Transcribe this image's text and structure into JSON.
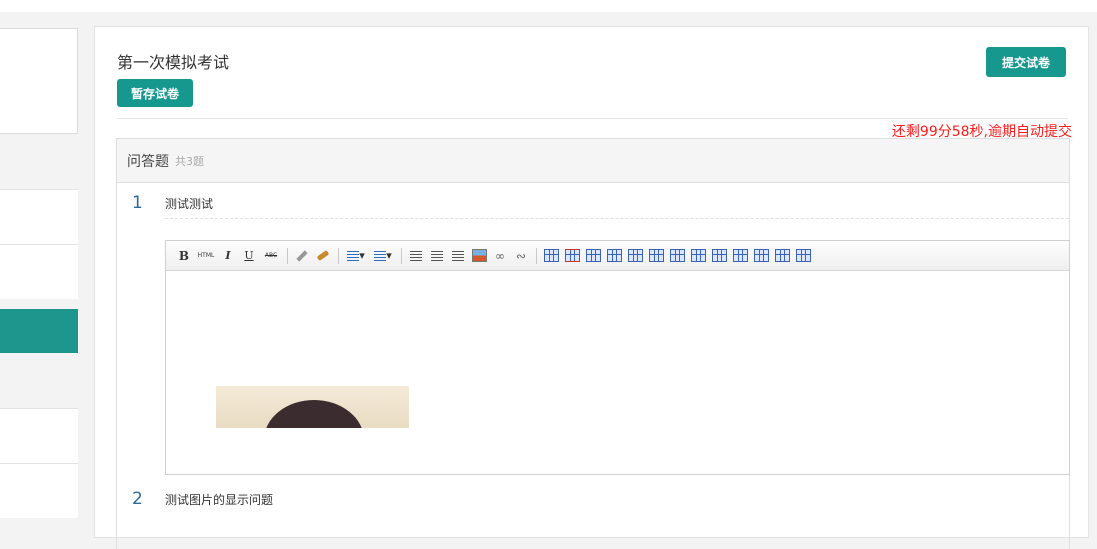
{
  "exam": {
    "title": "第一次模拟考试",
    "save_label": "暂存试卷",
    "submit_label": "提交试卷",
    "timer_text": "还剩99分58秒,逾期自动提交"
  },
  "section": {
    "title": "问答题",
    "count": "共3题"
  },
  "questions": [
    {
      "number": "1",
      "text": "测试测试"
    },
    {
      "number": "2",
      "text": "测试图片的显示问题"
    }
  ],
  "editor": {
    "toolbar": [
      "bold-icon",
      "html-icon",
      "italic-icon",
      "underline-icon",
      "strikethrough-icon",
      "eraser-icon",
      "format-brush-icon",
      "ordered-list-icon",
      "unordered-list-icon",
      "align-left-icon",
      "align-center-icon",
      "align-right-icon",
      "image-icon",
      "link-icon",
      "unlink-icon",
      "table-icon",
      "delete-table-icon",
      "insert-row-icon",
      "insert-col-icon",
      "merge-icon",
      "split-icon"
    ],
    "content": ""
  },
  "colors": {
    "accent": "#17988f",
    "timer": "#ff1a1a",
    "question_number": "#2b6a9c"
  }
}
